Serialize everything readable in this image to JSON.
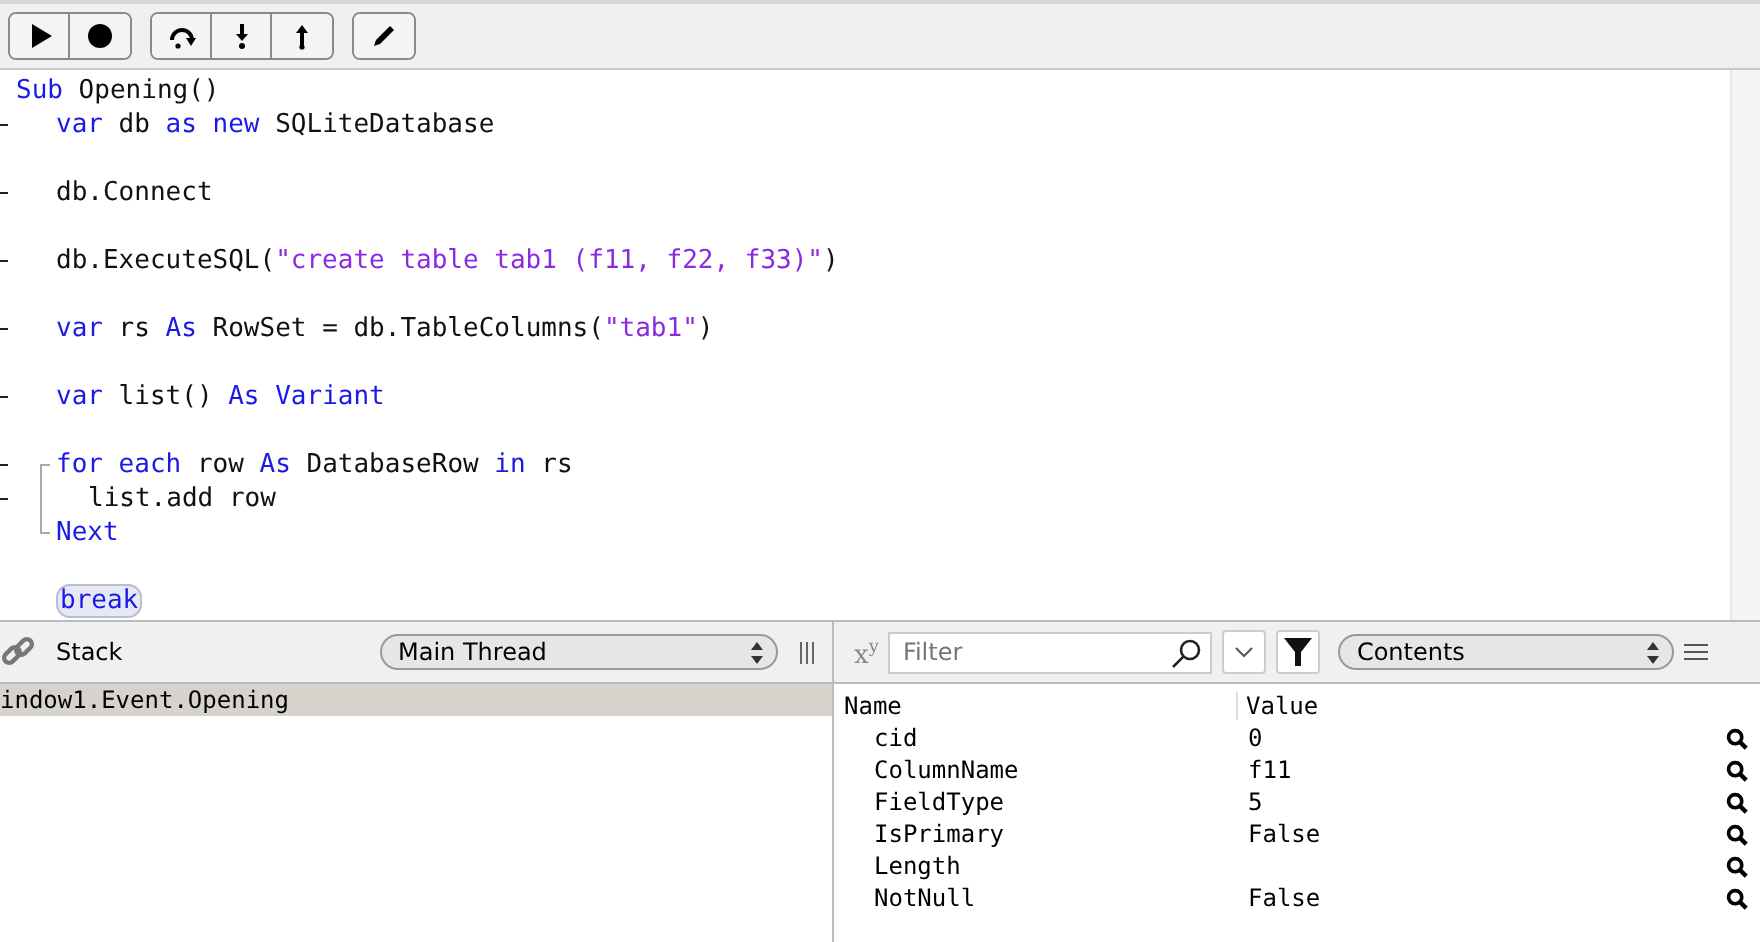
{
  "toolbar": {
    "groups": [
      {
        "buttons": [
          {
            "kind": "play"
          },
          {
            "kind": "record"
          }
        ]
      },
      {
        "buttons": [
          {
            "kind": "step-over"
          },
          {
            "kind": "step-into"
          },
          {
            "kind": "step-out"
          }
        ]
      },
      {
        "buttons": [
          {
            "kind": "edit"
          }
        ]
      }
    ]
  },
  "code": {
    "lines": [
      {
        "marker": false,
        "tokens": [
          {
            "kind": "keyword",
            "text": "Sub"
          },
          {
            "kind": "plain",
            "text": " Opening()"
          }
        ],
        "children": [
          {
            "marker": true,
            "tokens": [
              {
                "kind": "keyword",
                "text": "var"
              },
              {
                "kind": "plain",
                "text": " db "
              },
              {
                "kind": "keyword",
                "text": "as new"
              },
              {
                "kind": "plain",
                "text": " SQLiteDatabase"
              }
            ]
          },
          {
            "marker": false
          },
          {
            "marker": true,
            "tokens": [
              {
                "kind": "plain",
                "text": "db.Connect"
              }
            ]
          },
          {
            "marker": false
          },
          {
            "marker": true,
            "tokens": [
              {
                "kind": "plain",
                "text": "db.ExecuteSQL("
              },
              {
                "kind": "string",
                "text": "\"create table tab1 (f11, f22, f33)\""
              },
              {
                "kind": "plain",
                "text": ")"
              }
            ]
          },
          {
            "marker": false
          },
          {
            "marker": true,
            "tokens": [
              {
                "kind": "keyword",
                "text": "var"
              },
              {
                "kind": "plain",
                "text": " rs "
              },
              {
                "kind": "keyword",
                "text": "As"
              },
              {
                "kind": "plain",
                "text": " RowSet = db.TableColumns("
              },
              {
                "kind": "string",
                "text": "\"tab1\""
              },
              {
                "kind": "plain",
                "text": ")"
              }
            ]
          },
          {
            "marker": false
          },
          {
            "marker": true,
            "tokens": [
              {
                "kind": "keyword",
                "text": "var"
              },
              {
                "kind": "plain",
                "text": " list() "
              },
              {
                "kind": "keyword",
                "text": "As Variant"
              }
            ]
          },
          {
            "marker": false
          },
          {
            "marker": true,
            "fold": true,
            "tokens": [
              {
                "kind": "keyword",
                "text": "for each"
              },
              {
                "kind": "plain",
                "text": " row "
              },
              {
                "kind": "keyword",
                "text": "As"
              },
              {
                "kind": "plain",
                "text": " DatabaseRow "
              },
              {
                "kind": "keyword",
                "text": "in"
              },
              {
                "kind": "plain",
                "text": " rs"
              }
            ],
            "children": [
              {
                "marker": true,
                "tokens": [
                  {
                    "kind": "plain",
                    "text": "list.add row"
                  }
                ]
              }
            ],
            "end": {
              "marker": false,
              "tokens": [
                {
                  "kind": "keyword",
                  "text": "Next"
                }
              ]
            }
          },
          {
            "marker": false
          },
          {
            "marker": false,
            "tokens": [
              {
                "kind": "pill",
                "text": "break"
              }
            ]
          }
        ]
      }
    ]
  },
  "stack": {
    "title": "Stack",
    "thread": "Main Thread",
    "frames": [
      {
        "text": "indow1.Event.Opening",
        "selected": true
      }
    ]
  },
  "variables": {
    "format_label": "x$^{y}$",
    "filter_placeholder": "Filter",
    "view": "Contents",
    "columns": [
      "Name",
      "Value"
    ],
    "rows": [
      {
        "name": "cid",
        "value": "0"
      },
      {
        "name": "ColumnName",
        "value": "f11"
      },
      {
        "name": "FieldType",
        "value": "5"
      },
      {
        "name": "IsPrimary",
        "value": "False"
      },
      {
        "name": "Length"
      },
      {
        "name": "NotNull",
        "value": "False"
      }
    ]
  }
}
